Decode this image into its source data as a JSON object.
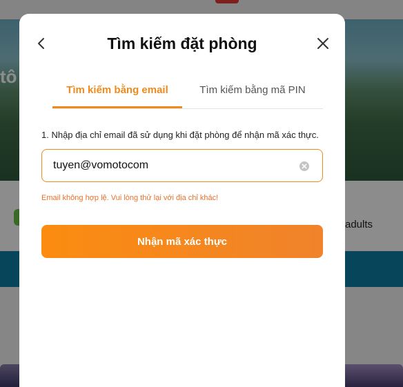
{
  "background": {
    "hero_text": "tô",
    "adults_text": "adults"
  },
  "modal": {
    "title": "Tìm kiếm đặt phòng",
    "tabs": [
      {
        "label": "Tìm kiếm bằng email",
        "active": true
      },
      {
        "label": "Tìm kiếm bằng mã PIN",
        "active": false
      }
    ],
    "instruction": "1. Nhập địa chỉ email đã sử dụng khi đặt phòng để nhận mã xác thực.",
    "email_input": {
      "value": "tuyen@vomotocom"
    },
    "error_message": "Email không hợp lệ. Vui lòng thử lại với địa chỉ khác!",
    "submit_label": "Nhận mã xác thực"
  },
  "icons": {
    "back": "chevron-left-icon",
    "close": "close-icon",
    "clear": "clear-circle-icon"
  },
  "colors": {
    "accent": "#f08a1a",
    "error": "#e8712b",
    "button_gradient_start": "#fb8c10",
    "button_gradient_end": "#f0832b"
  }
}
